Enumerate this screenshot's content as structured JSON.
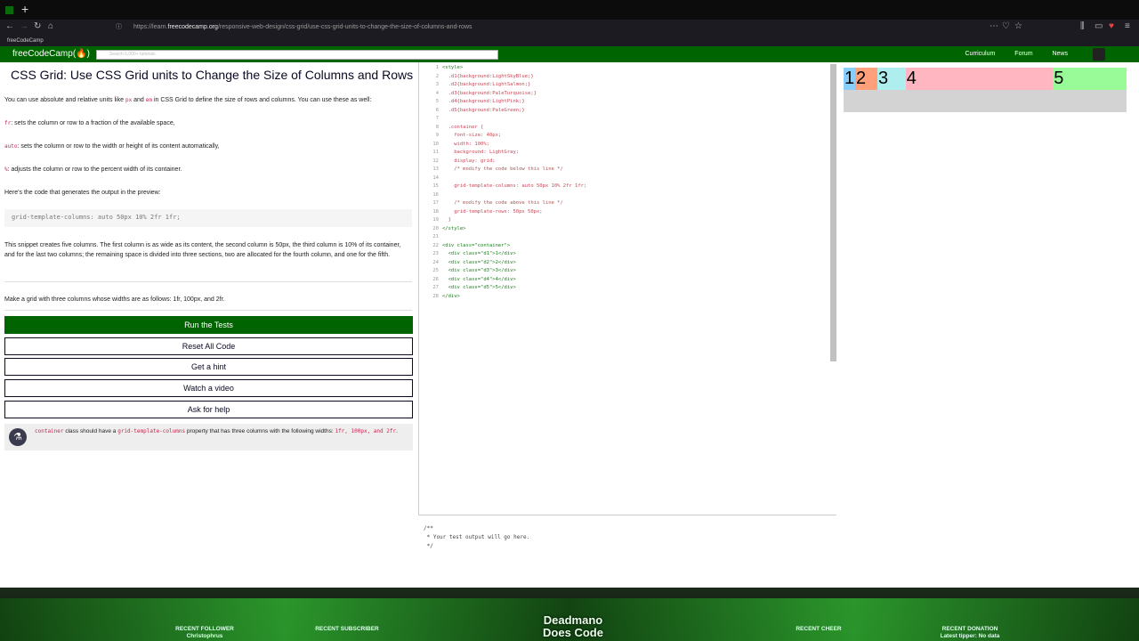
{
  "browser": {
    "url_prefix": "https://learn.",
    "url_domain": "freecodecamp.org",
    "url_path": "/responsive-web-design/css-grid/use-css-grid-units-to-change-the-size-of-columns-and-rows",
    "bookmark": "freeCodeCamp"
  },
  "fcc": {
    "logo": "freeCodeCamp(🔥)",
    "search_placeholder": "Search 6,000+ tutorials",
    "nav": [
      "Curriculum",
      "Forum",
      "News"
    ]
  },
  "lesson": {
    "title": "CSS Grid: Use CSS Grid units to Change the Size of Columns and Rows",
    "intro_a": "You can use absolute and relative units like ",
    "intro_px": "px",
    "intro_and": " and ",
    "intro_em": "em",
    "intro_b": " in CSS Grid to define the size of rows and columns. You can use these as well:",
    "fr_code": "fr",
    "fr_text": ": sets the column or row to a fraction of the available space,",
    "auto_code": "auto",
    "auto_text": ": sets the column or row to the width or height of its content automatically,",
    "pct_code": "%",
    "pct_text": ": adjusts the column or row to the percent width of its container.",
    "code_intro": "Here's the code that generates the output in the preview:",
    "snippet": "grid-template-columns: auto 50px 10% 2fr 1fr;",
    "explain": "This snippet creates five columns. The first column is as wide as its content, the second column is 50px, the third column is 10% of its container, and for the last two columns; the remaining space is divided into three sections, two are allocated for the fourth column, and one for the fifth.",
    "task": "Make a grid with three columns whose widths are as follows: 1fr, 100px, and 2fr.",
    "buttons": {
      "run": "Run the Tests",
      "reset": "Reset All Code",
      "hint": "Get a hint",
      "video": "Watch a video",
      "help": "Ask for help"
    },
    "test_icon": "⚗",
    "test_code1": "container",
    "test_text1": " class should have a ",
    "test_code2": "grid-template-columns",
    "test_text2": " property that has three columns with the following widths: ",
    "test_code3": "1fr, 100px, and 2fr",
    "test_text3": "."
  },
  "editor": {
    "lines": [
      {
        "n": "1",
        "t": "<style>"
      },
      {
        "n": "2",
        "t": "  .d1{background:LightSkyBlue;}"
      },
      {
        "n": "3",
        "t": "  .d2{background:LightSalmon;}"
      },
      {
        "n": "4",
        "t": "  .d3{background:PaleTurquoise;}"
      },
      {
        "n": "5",
        "t": "  .d4{background:LightPink;}"
      },
      {
        "n": "6",
        "t": "  .d5{background:PaleGreen;}"
      },
      {
        "n": "7",
        "t": ""
      },
      {
        "n": "8",
        "t": "  .container {"
      },
      {
        "n": "9",
        "t": "    font-size: 40px;"
      },
      {
        "n": "10",
        "t": "    width: 100%;"
      },
      {
        "n": "11",
        "t": "    background: LightGray;"
      },
      {
        "n": "12",
        "t": "    display: grid;"
      },
      {
        "n": "13",
        "t": "    /* modify the code below this line */"
      },
      {
        "n": "14",
        "t": ""
      },
      {
        "n": "15",
        "t": "    grid-template-columns: auto 50px 10% 2fr 1fr;"
      },
      {
        "n": "16",
        "t": ""
      },
      {
        "n": "17",
        "t": "    /* modify the code above this line */"
      },
      {
        "n": "18",
        "t": "    grid-template-rows: 50px 50px;"
      },
      {
        "n": "19",
        "t": "  }"
      },
      {
        "n": "20",
        "t": "</style>"
      },
      {
        "n": "21",
        "t": ""
      },
      {
        "n": "22",
        "t": "<div class=\"container\">"
      },
      {
        "n": "23",
        "t": "  <div class=\"d1\">1</div>"
      },
      {
        "n": "24",
        "t": "  <div class=\"d2\">2</div>"
      },
      {
        "n": "25",
        "t": "  <div class=\"d3\">3</div>"
      },
      {
        "n": "26",
        "t": "  <div class=\"d4\">4</div>"
      },
      {
        "n": "27",
        "t": "  <div class=\"d5\">5</div>"
      },
      {
        "n": "28",
        "t": "</div>"
      }
    ],
    "console": "/**\n * Your test output will go here.\n */"
  },
  "preview": {
    "cells": [
      {
        "label": "1",
        "color": "#87CEFA"
      },
      {
        "label": "2",
        "color": "#FFA07A"
      },
      {
        "label": "3",
        "color": "#AFEEEE"
      },
      {
        "label": "4",
        "color": "#FFB6C1"
      },
      {
        "label": "5",
        "color": "#98FB98"
      }
    ]
  },
  "overlay": {
    "brand_line1": "Deadmano",
    "brand_line2": "Does Code",
    "recent_follower": "RECENT FOLLOWER",
    "follower_name": "Christophrus",
    "recent_subscriber": "RECENT SUBSCRIBER",
    "recent_cheer": "RECENT CHEER",
    "recent_donation": "RECENT DONATION",
    "donation_note": "Latest tipper: No data"
  }
}
